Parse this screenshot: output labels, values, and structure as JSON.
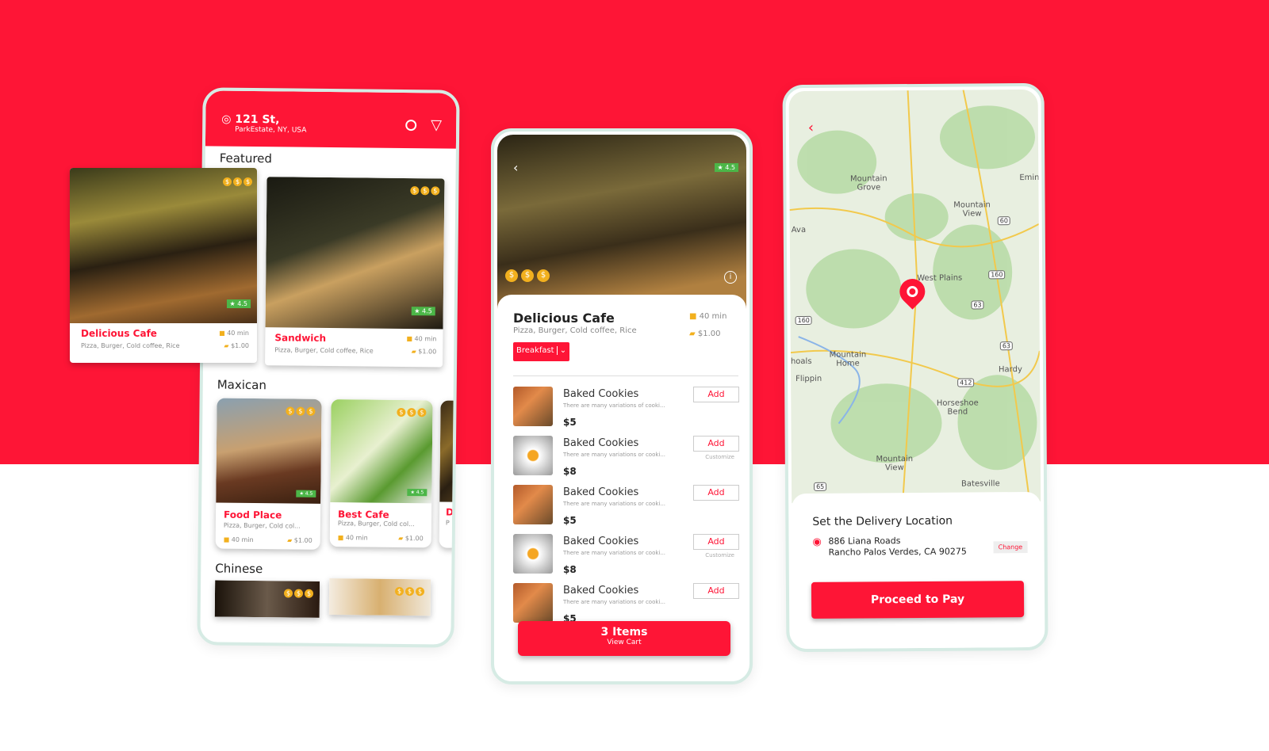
{
  "colors": {
    "brand": "#fe1536",
    "rating": "#4cb648",
    "coin": "#f2b01e",
    "frame": "#d6ebe4"
  },
  "home": {
    "address_line1": "121 St,",
    "address_line2": "ParkEstate, NY, USA",
    "icons": [
      "location-icon",
      "search-icon",
      "filter-icon"
    ],
    "featured_title": "Featured",
    "featured": [
      {
        "name": "Delicious Cafe",
        "cuisines": "Pizza, Burger, Cold coffee, Rice",
        "time": "40 min",
        "cost": "$1.00",
        "rating": "4.5",
        "price_symbols": "$$$"
      },
      {
        "name": "Sandwich",
        "cuisines": "Pizza, Burger, Cold coffee, Rice",
        "time": "40 min",
        "cost": "$1.00",
        "rating": "4.5",
        "price_symbols": "$$$"
      }
    ],
    "mexican_title": "Maxican",
    "mexican": [
      {
        "name": "Food Place",
        "cuisines": "Pizza, Burger, Cold col...",
        "time": "40 min",
        "cost": "$1.00",
        "rating": "4.5"
      },
      {
        "name": "Best Cafe",
        "cuisines": "Pizza, Burger, Cold col...",
        "time": "40 min",
        "cost": "$1.00",
        "rating": "4.5"
      },
      {
        "name": "D",
        "cuisines": "P"
      }
    ],
    "chinese_title": "Chinese"
  },
  "detail": {
    "rating": "4.5",
    "name": "Delicious Cafe",
    "cuisines": "Pizza, Burger, Cold coffee, Rice",
    "time": "40 min",
    "cost": "$1.00",
    "menu_select": "Breakfast",
    "items": [
      {
        "name": "Baked Cookies",
        "desc": "There are many variations of cooki...",
        "price": "$5",
        "add": "Add",
        "customize": ""
      },
      {
        "name": "Baked Cookies",
        "desc": "There are many variations or cooki...",
        "price": "$8",
        "add": "Add",
        "customize": "Customize"
      },
      {
        "name": "Baked Cookies",
        "desc": "There are many variations or cooki...",
        "price": "$5",
        "add": "Add",
        "customize": ""
      },
      {
        "name": "Baked Cookies",
        "desc": "There are many variations or cooki...",
        "price": "$8",
        "add": "Add",
        "customize": "Customize"
      },
      {
        "name": "Baked Cookies",
        "desc": "There are many variations or cooki...",
        "price": "$5",
        "add": "Add",
        "customize": ""
      }
    ],
    "cart_count": "3 Items",
    "cart_label": "View Cart"
  },
  "location": {
    "map_labels": [
      "Mountain Grove",
      "Emine",
      "Mountain View",
      "Ava",
      "West Plains",
      "Mountain Home",
      "Hardy",
      "Flippin",
      "Horseshoe Bend",
      "Mountain View",
      "Batesville",
      "hoals"
    ],
    "shields": [
      "60",
      "160",
      "63",
      "160",
      "63",
      "412",
      "65"
    ],
    "title": "Set the Delivery Location",
    "address_line1": "886 Liana Roads",
    "address_line2": "Rancho Palos Verdes, CA 90275",
    "change": "Change",
    "proceed": "Proceed to Pay"
  }
}
